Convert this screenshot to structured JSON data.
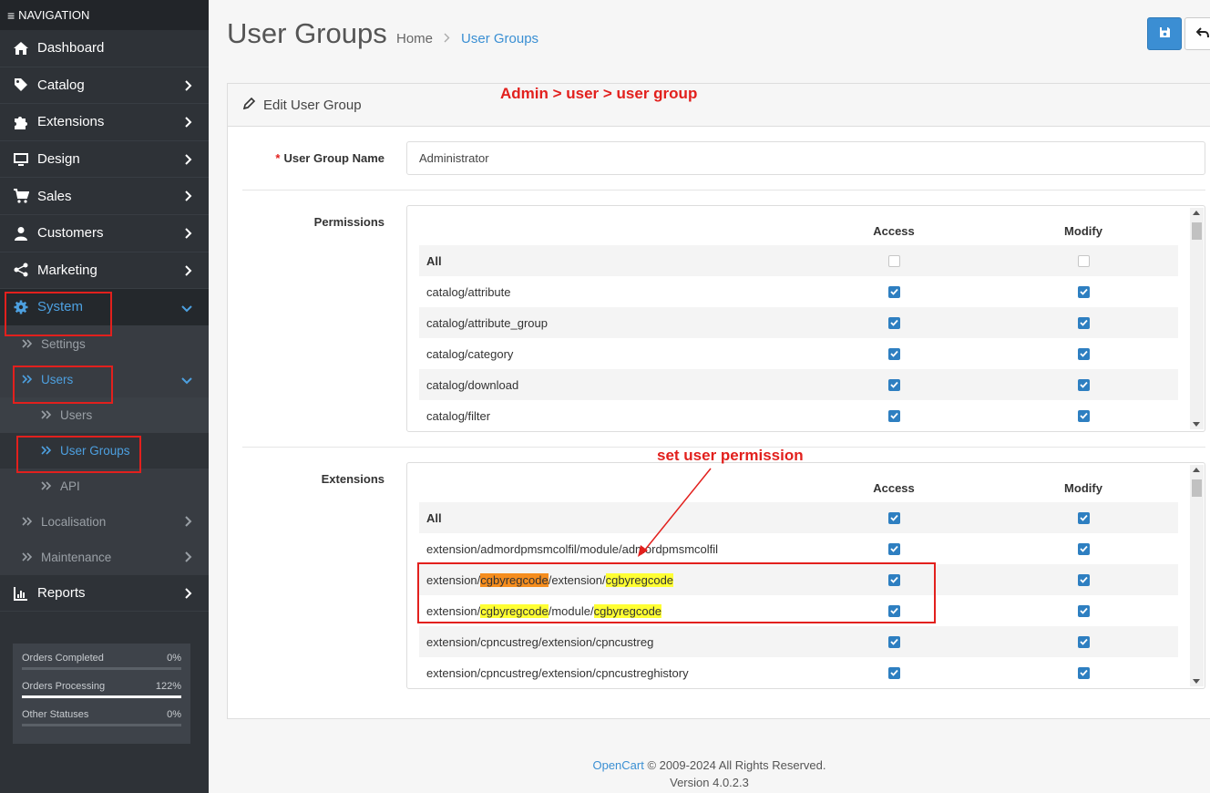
{
  "sidebar": {
    "header": "NAVIGATION",
    "items": [
      {
        "label": "Dashboard",
        "icon": "home-icon"
      },
      {
        "label": "Catalog",
        "icon": "tag-icon"
      },
      {
        "label": "Extensions",
        "icon": "puzzle-icon"
      },
      {
        "label": "Design",
        "icon": "monitor-icon"
      },
      {
        "label": "Sales",
        "icon": "cart-icon"
      },
      {
        "label": "Customers",
        "icon": "user-icon"
      },
      {
        "label": "Marketing",
        "icon": "share-icon"
      },
      {
        "label": "System",
        "icon": "gear-icon"
      }
    ],
    "system_sub": {
      "settings": "Settings",
      "users": "Users",
      "users_sub": [
        "Users",
        "User Groups"
      ],
      "api": "API",
      "localisation": "Localisation",
      "maintenance": "Maintenance"
    },
    "reports": {
      "label": "Reports",
      "icon": "bar-chart-icon"
    },
    "stats": [
      {
        "label": "Orders Completed",
        "value": "0%",
        "fraction": 0
      },
      {
        "label": "Orders Processing",
        "value": "122%",
        "fraction": 1
      },
      {
        "label": "Other Statuses",
        "value": "0%",
        "fraction": 0
      }
    ]
  },
  "header": {
    "title": "User Groups",
    "breadcrumb": [
      "Home",
      "User Groups"
    ]
  },
  "card": {
    "title": "Edit User Group",
    "annotation_top": "Admin > user > user group",
    "annotation_mid": "set user permission"
  },
  "form": {
    "name_label": "User Group Name",
    "name_value": "Administrator",
    "permissions_label": "Permissions",
    "extensions_label": "Extensions"
  },
  "permissions": {
    "headers": {
      "access": "Access",
      "modify": "Modify"
    },
    "rows": [
      {
        "name": "All",
        "access": false,
        "modify": false
      },
      {
        "name": "catalog/attribute",
        "access": true,
        "modify": true
      },
      {
        "name": "catalog/attribute_group",
        "access": true,
        "modify": true
      },
      {
        "name": "catalog/category",
        "access": true,
        "modify": true
      },
      {
        "name": "catalog/download",
        "access": true,
        "modify": true
      },
      {
        "name": "catalog/filter",
        "access": true,
        "modify": true
      }
    ]
  },
  "extensions": {
    "headers": {
      "access": "Access",
      "modify": "Modify"
    },
    "rows": [
      {
        "name": "All",
        "access": true,
        "modify": true
      },
      {
        "name": "extension/admordpmsmcolfil/module/admordpmsmcolfil",
        "access": true,
        "modify": true
      },
      {
        "name_parts": [
          "extension/",
          "cgbyregcode",
          "/extension/",
          "cgbyregcode"
        ],
        "access": true,
        "modify": true
      },
      {
        "name_parts": [
          "extension/",
          "cgbyregcode",
          "/module/",
          "cgbyregcode"
        ],
        "access": true,
        "modify": true
      },
      {
        "name": "extension/cpncustreg/extension/cpncustreg",
        "access": true,
        "modify": true
      },
      {
        "name": "extension/cpncustreg/extension/cpncustreghistory",
        "access": true,
        "modify": true
      }
    ]
  },
  "footer": {
    "brand": "OpenCart",
    "copyright": " © 2009-2024 All Rights Reserved.",
    "version": "Version 4.0.2.3"
  },
  "colors": {
    "accent": "#3a8fd3",
    "annotation": "#e2201d",
    "sidebar_bg": "#2e3237",
    "highlight_yellow": "#ffff33",
    "highlight_orange": "#f58d1e"
  }
}
